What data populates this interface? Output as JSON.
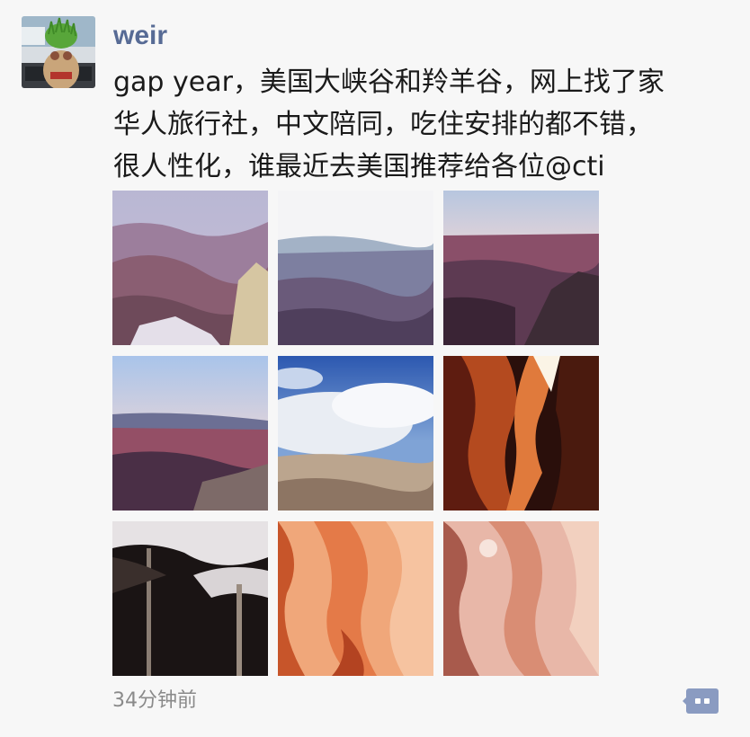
{
  "post": {
    "username": "weir",
    "text": "gap year，美国大峡谷和羚羊谷，网上找了家\n华人旅行社，中文陪同，吃住安排的都不错，\n很人性化，谁最近去美国推荐给各位@cti",
    "timestamp": "34分钟前",
    "photos": [
      {
        "subject": "grand-canyon-dusk"
      },
      {
        "subject": "grand-canyon-bright-sky"
      },
      {
        "subject": "grand-canyon-sunset-ridge"
      },
      {
        "subject": "grand-canyon-horizon"
      },
      {
        "subject": "grand-canyon-clouds"
      },
      {
        "subject": "antelope-canyon-light-beam"
      },
      {
        "subject": "antelope-canyon-sand-falls"
      },
      {
        "subject": "antelope-canyon-orange-waves"
      },
      {
        "subject": "antelope-canyon-pink-waves"
      }
    ]
  },
  "icons": {
    "avatar": "avatar-grass-doll",
    "comment": "comment-bubble-icon"
  },
  "colors": {
    "username": "#576b95",
    "text": "#1a1a1a",
    "timestamp": "#8a8a8a",
    "comment_icon": "#8a9bc1",
    "background": "#f7f7f7"
  }
}
